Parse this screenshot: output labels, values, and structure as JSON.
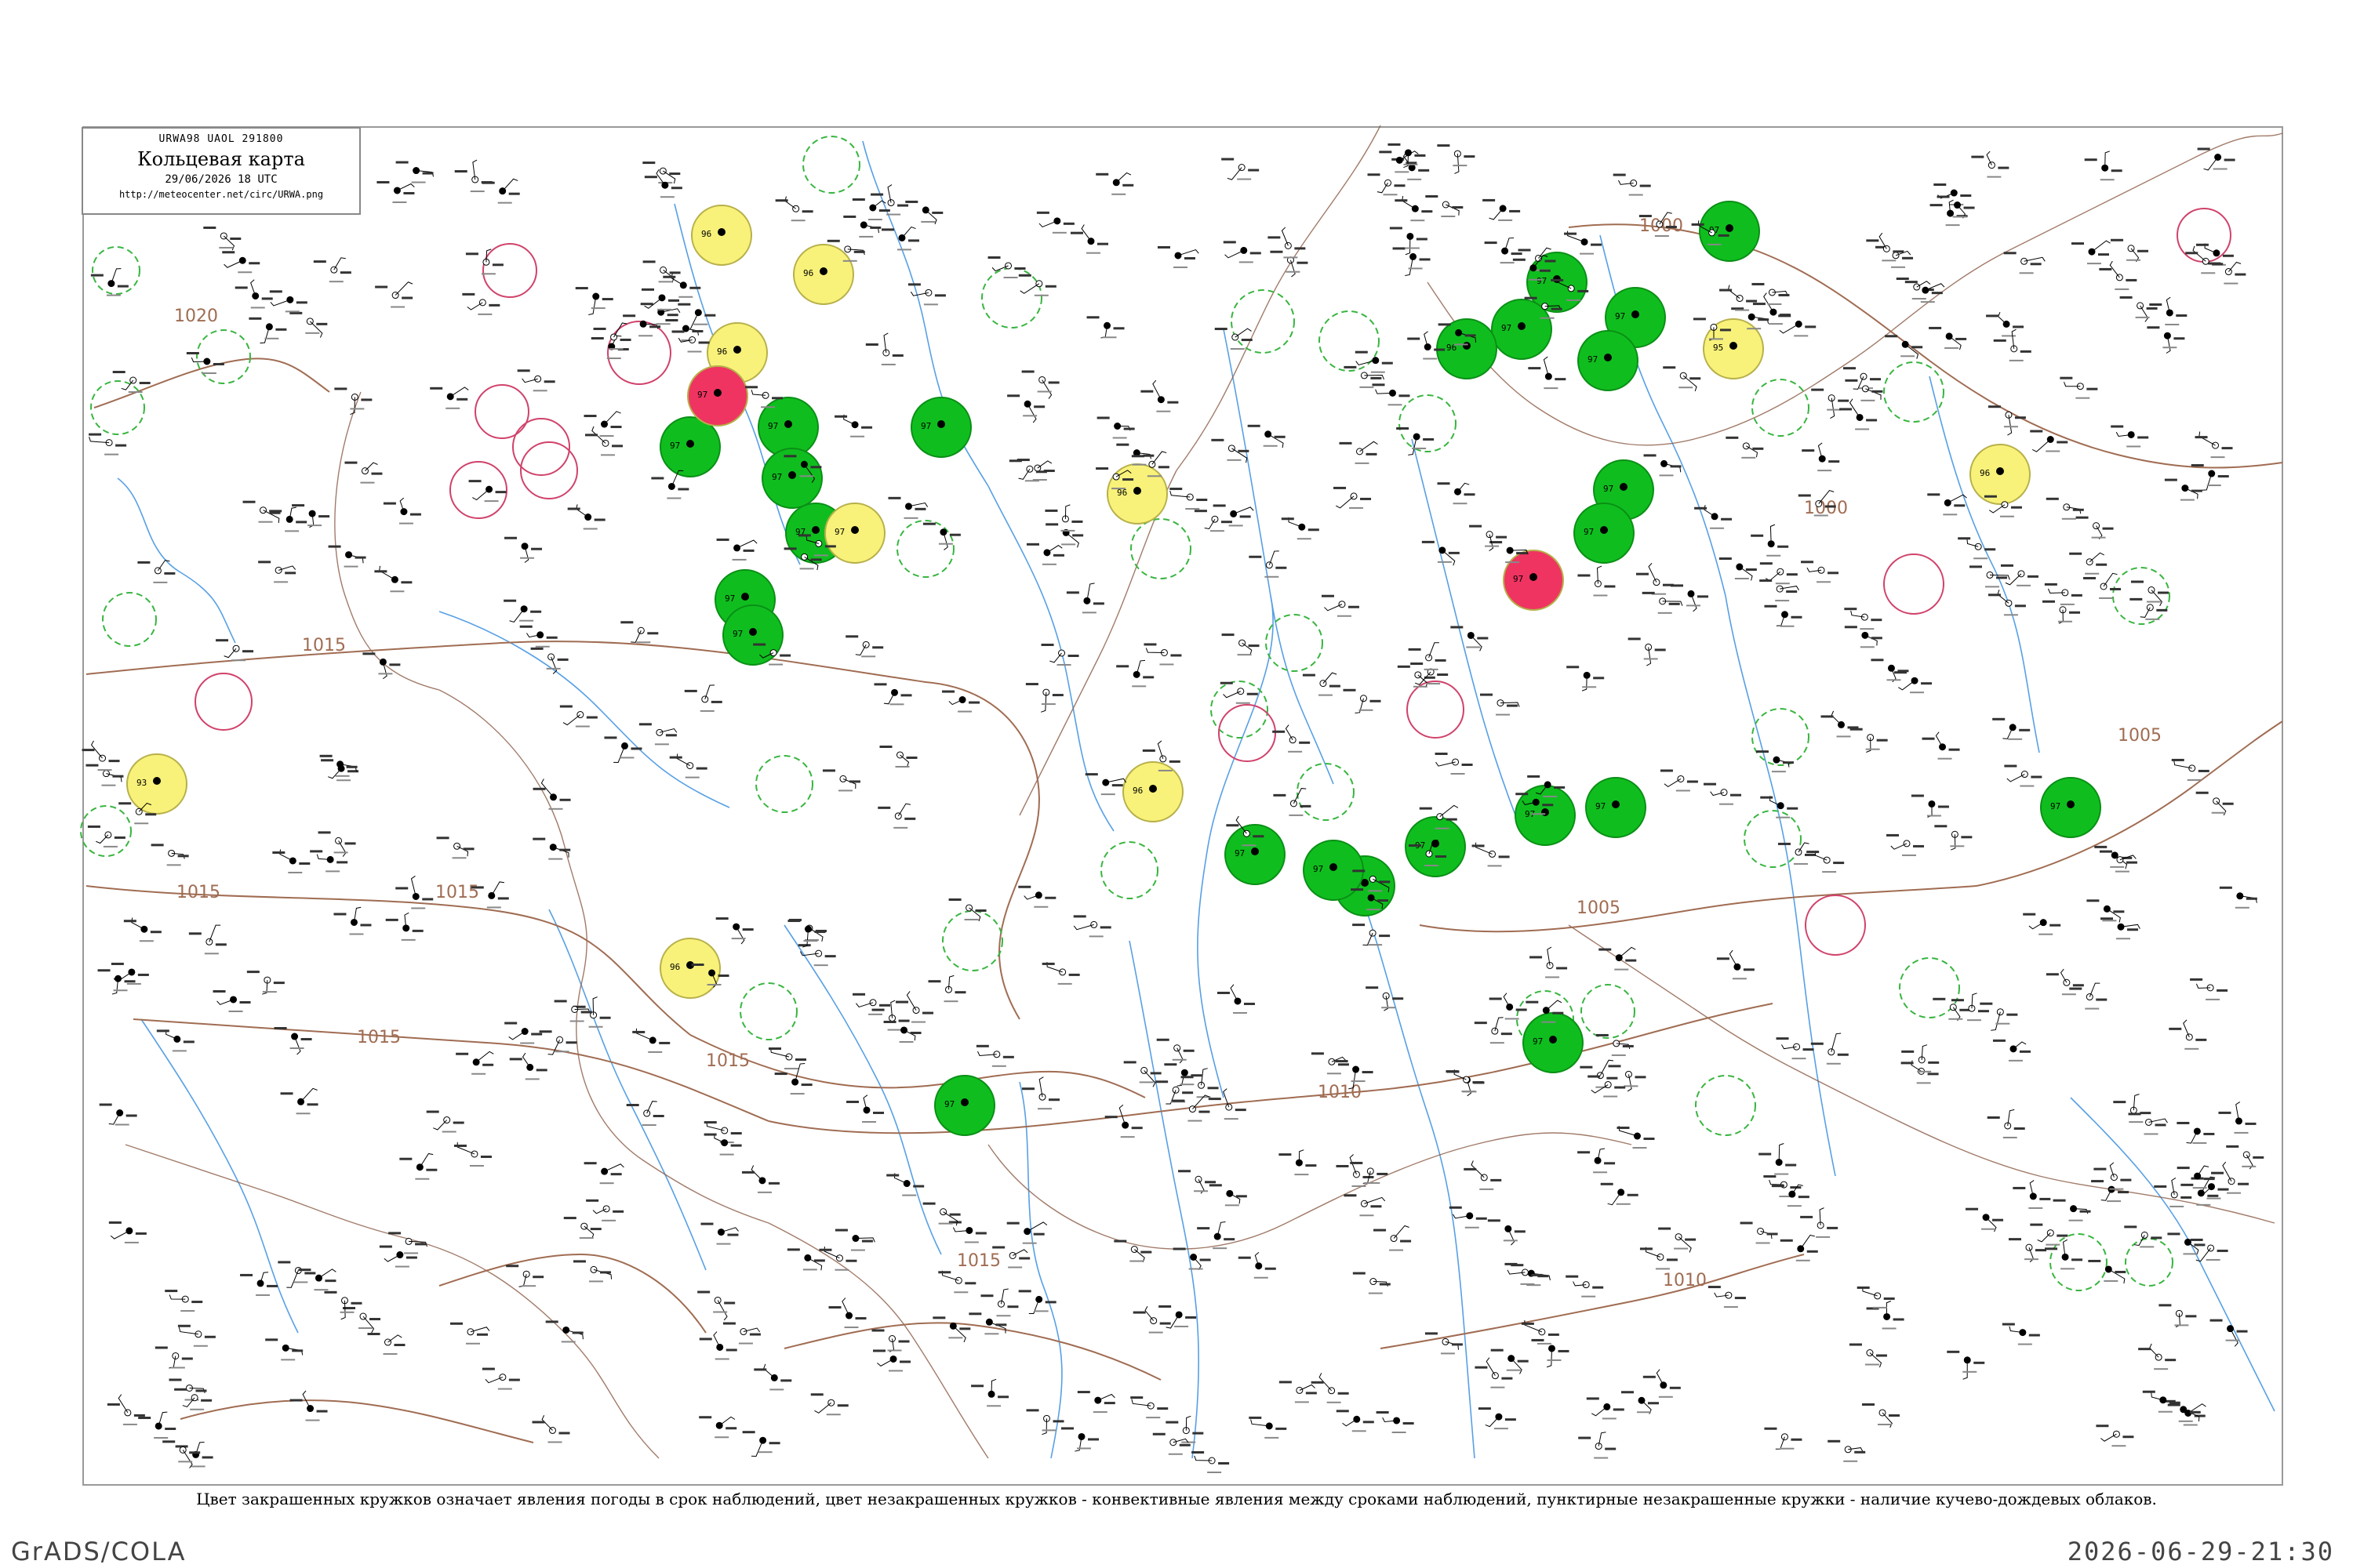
{
  "header": {
    "code_line": "URWA98  UAOL  291800",
    "title": "Кольцевая карта",
    "date_line": "29/06/2026 18 UTC",
    "url": "http://meteocenter.net/circ/URWA.png"
  },
  "caption": "Цвет закрашенных кружков означает явления погоды в срок наблюдений, цвет незакрашенных кружков - конвективные явления между сроками наблюдений, пунктирные незакрашенные кружки - наличие кучево-дождевых облаков.",
  "footer": {
    "left": "GrADS/COLA",
    "right": "2026-06-29-21:30"
  },
  "colors": {
    "green": "#0fbe1e",
    "yellow": "#f8f27a",
    "red": "#ef3461",
    "isobar": "#a06c52",
    "river": "#3a8fe0",
    "dashed_green": "#38b540",
    "dashed_pink": "#d0426b"
  },
  "isobar_labels": [
    "1000",
    "1000",
    "1005",
    "1005",
    "1010",
    "1010",
    "1015",
    "1015",
    "1015",
    "1015",
    "1015",
    "1015",
    "1020"
  ],
  "stations": [
    {
      "id": "s1",
      "text": "97",
      "fill": "green"
    },
    {
      "id": "s2",
      "text": "97",
      "fill": "green"
    },
    {
      "id": "s3",
      "text": "97",
      "fill": "green"
    },
    {
      "id": "s4",
      "text": "97",
      "fill": "green"
    },
    {
      "id": "s5",
      "text": "97",
      "fill": "green"
    },
    {
      "id": "s6",
      "text": "96",
      "fill": "green"
    },
    {
      "id": "s7",
      "text": "97",
      "fill": "green"
    },
    {
      "id": "s8",
      "text": "97",
      "fill": "green"
    },
    {
      "id": "s9",
      "text": "97",
      "fill": "green"
    },
    {
      "id": "s10",
      "text": "97",
      "fill": "green"
    },
    {
      "id": "s11",
      "text": "97",
      "fill": "green"
    },
    {
      "id": "s12",
      "text": "97",
      "fill": "green"
    },
    {
      "id": "s13",
      "text": "97",
      "fill": "green"
    },
    {
      "id": "s14",
      "text": "97",
      "fill": "green"
    },
    {
      "id": "s15",
      "text": "97",
      "fill": "green"
    },
    {
      "id": "s16",
      "text": "97",
      "fill": "green"
    },
    {
      "id": "s17",
      "text": "97",
      "fill": "green"
    },
    {
      "id": "s18",
      "text": "97",
      "fill": "green"
    },
    {
      "id": "s19",
      "text": "97",
      "fill": "green"
    },
    {
      "id": "s20",
      "text": "97",
      "fill": "green"
    },
    {
      "id": "s21",
      "text": "97",
      "fill": "green"
    },
    {
      "id": "s22",
      "text": "97",
      "fill": "green"
    },
    {
      "id": "s23",
      "text": "97",
      "fill": "green"
    },
    {
      "id": "s24",
      "text": "97",
      "fill": "green"
    },
    {
      "id": "s25",
      "text": "96",
      "fill": "yellow"
    },
    {
      "id": "s26",
      "text": "96",
      "fill": "yellow"
    },
    {
      "id": "s27",
      "text": "96",
      "fill": "yellow"
    },
    {
      "id": "s28",
      "text": "97",
      "fill": "yellow"
    },
    {
      "id": "s29",
      "text": "96",
      "fill": "yellow"
    },
    {
      "id": "s30",
      "text": "96",
      "fill": "yellow"
    },
    {
      "id": "s31",
      "text": "95",
      "fill": "yellow"
    },
    {
      "id": "s32",
      "text": "96",
      "fill": "yellow"
    },
    {
      "id": "s33",
      "text": "93",
      "fill": "yellow"
    },
    {
      "id": "s34",
      "text": "96",
      "fill": "yellow"
    },
    {
      "id": "s35",
      "text": "97",
      "fill": "red"
    },
    {
      "id": "s36",
      "text": "97",
      "fill": "red"
    }
  ]
}
